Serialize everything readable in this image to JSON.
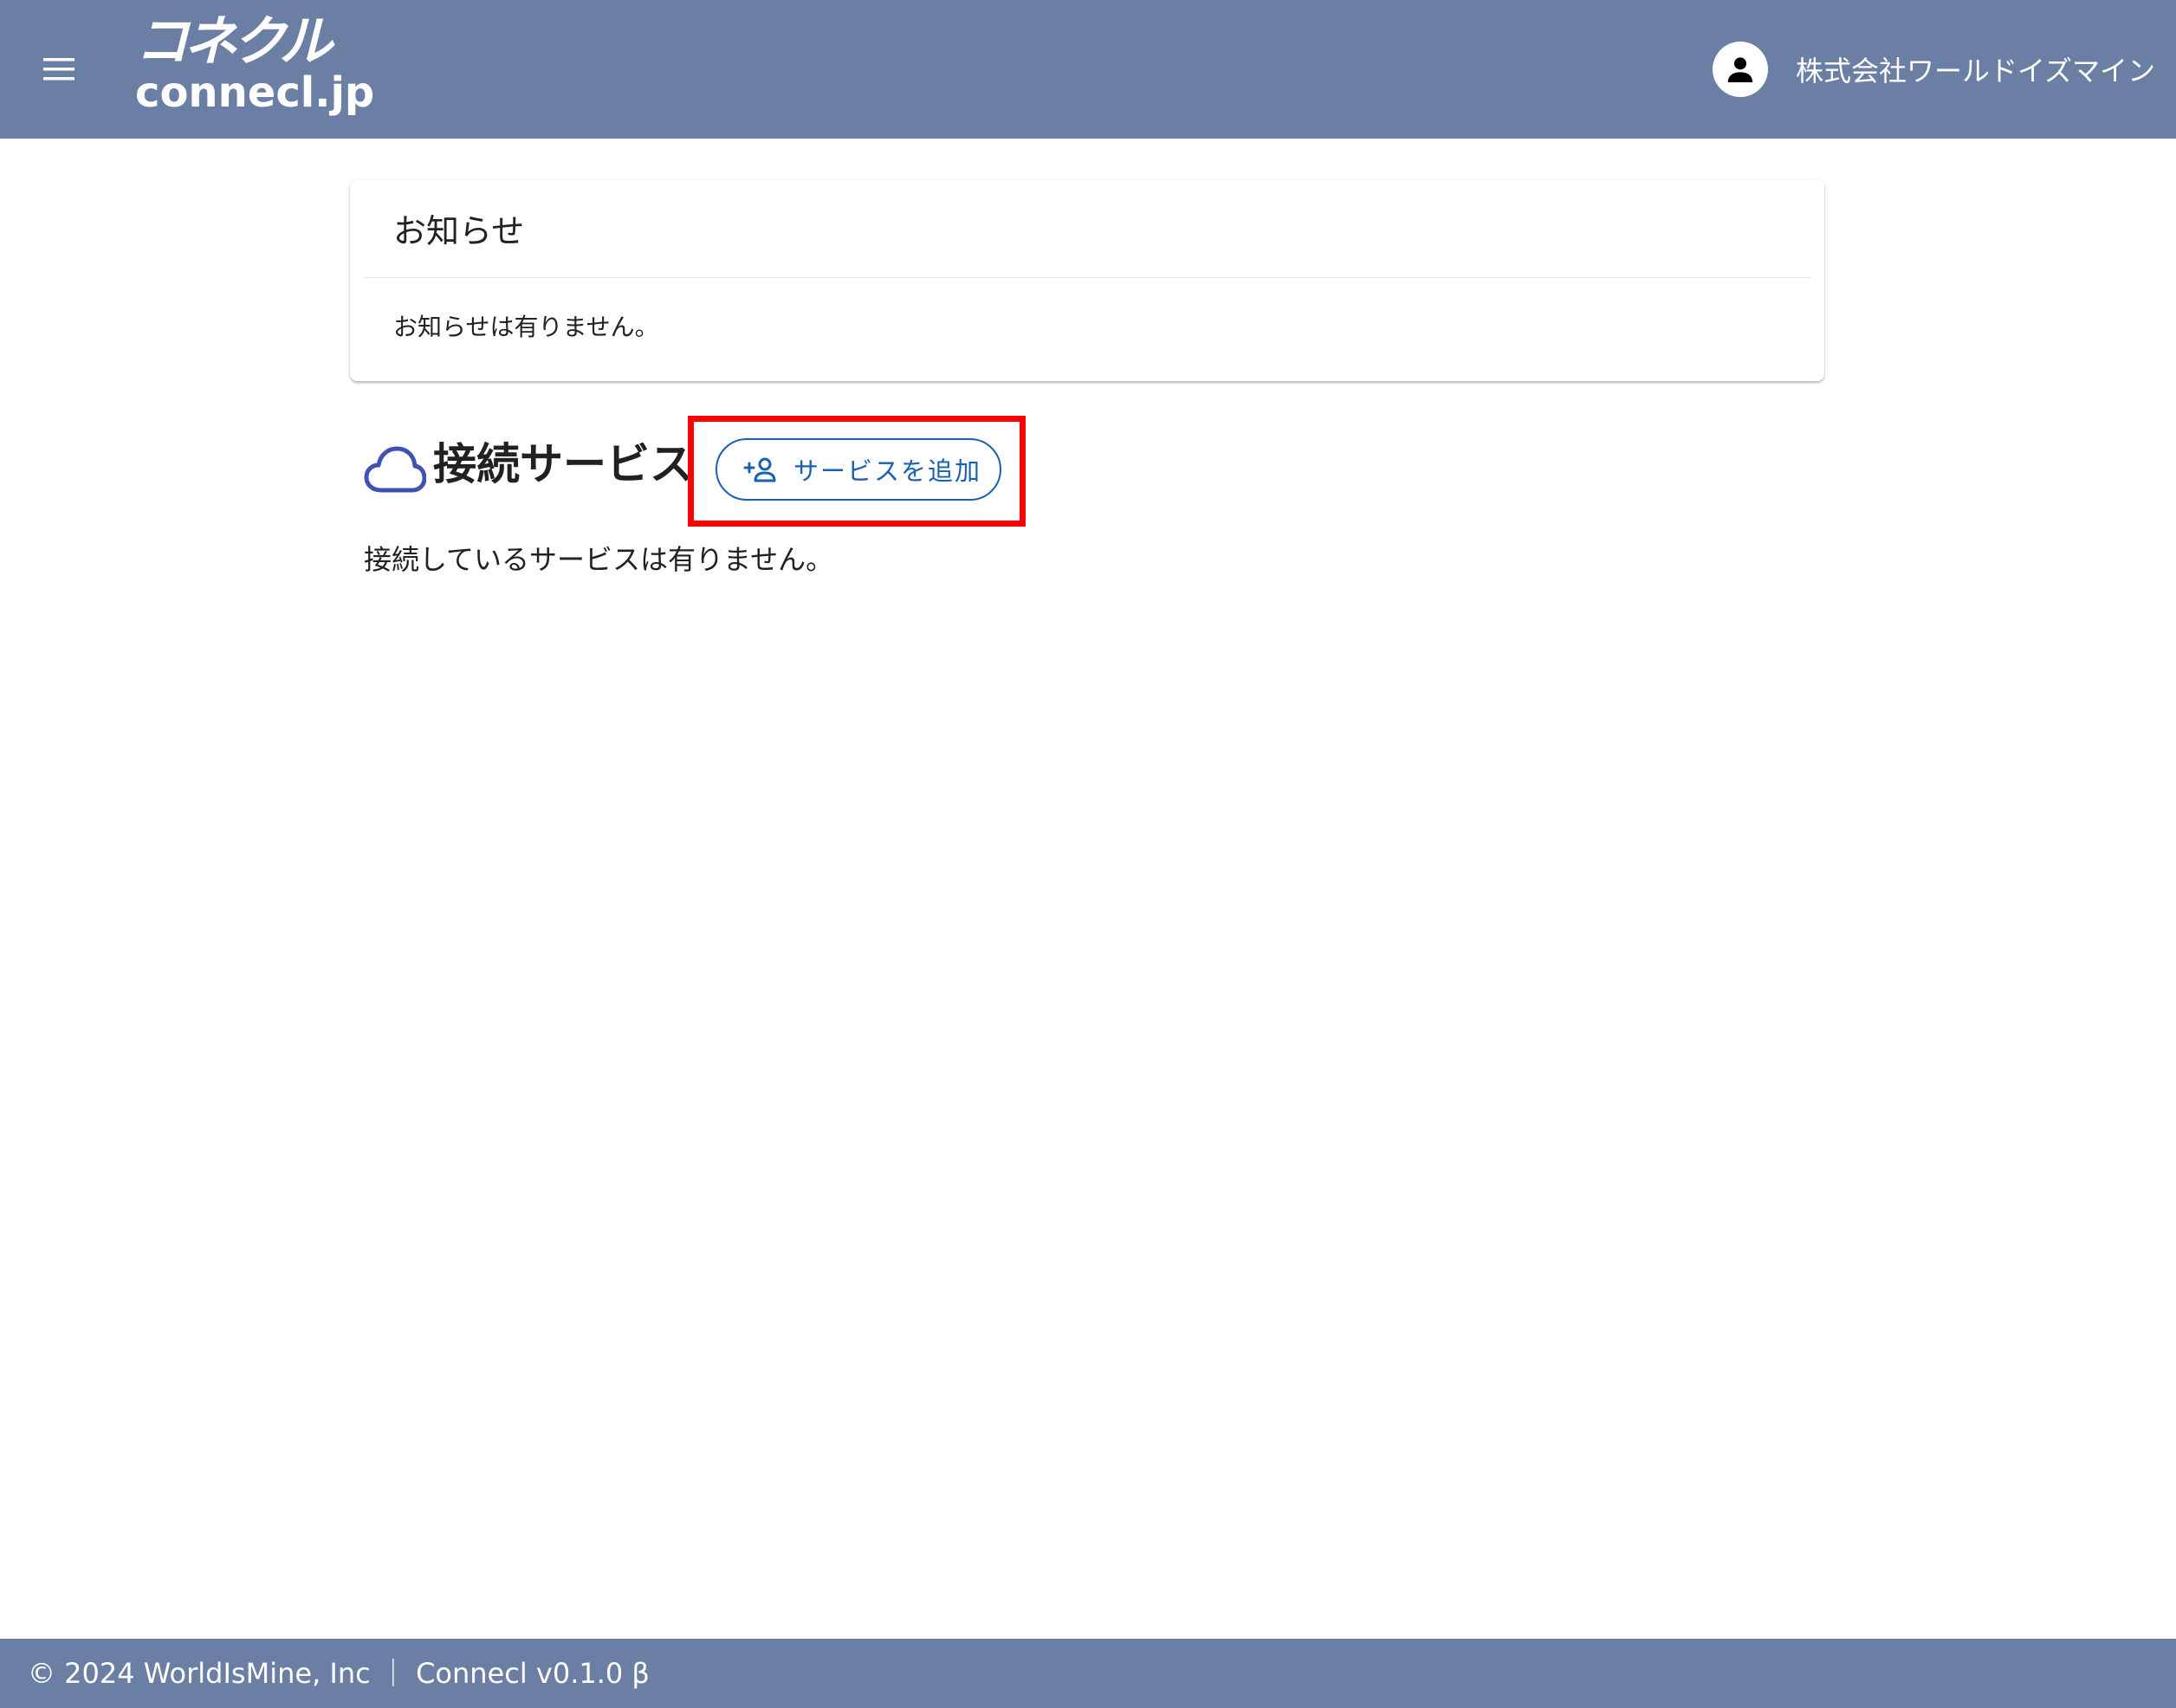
{
  "header": {
    "logo_kana": "コネクル",
    "logo_latin": "connecl.jp",
    "company_name": "株式会社ワールドイズマイン"
  },
  "notices": {
    "title": "お知らせ",
    "empty_text": "お知らせは有りません。"
  },
  "services": {
    "title": "接続サービス",
    "add_button_label": "サービスを追加",
    "empty_text": "接続しているサービスは有りません。"
  },
  "footer": {
    "text": "© 2024 WorldIsMine, Inc ｜ Connecl v0.1.0 β"
  },
  "icons": {
    "menu": "menu-icon",
    "avatar": "account-icon",
    "cloud": "cloud-icon",
    "add_person": "person-add-icon"
  },
  "colors": {
    "app_bar": "#6b7ea4",
    "accent": "#1a5fb4",
    "cloud_icon": "#3f51b5",
    "highlight": "#ff0000"
  }
}
